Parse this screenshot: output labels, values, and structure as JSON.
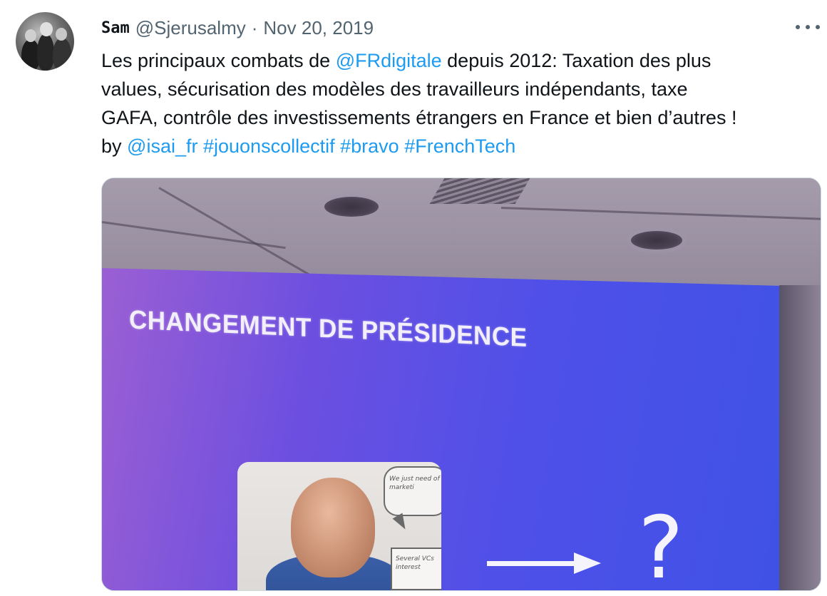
{
  "tweet": {
    "author": {
      "display_name": "Sam",
      "handle": "@Sjerusalmy",
      "separator": "·",
      "date": "Nov 20, 2019"
    },
    "more_icon": "more-horizontal-icon",
    "lines": [
      [
        {
          "text": "Les principaux combats de ",
          "link": false
        },
        {
          "text": "@FRdigitale",
          "link": true
        },
        {
          "text": " depuis 2012: Taxation des plus",
          "link": false
        }
      ],
      [
        {
          "text": "values, sécurisation des modèles des travailleurs indépendants, taxe",
          "link": false
        }
      ],
      [
        {
          "text": "GAFA, contrôle des investissements étrangers en France et bien d’autres !",
          "link": false
        }
      ],
      [
        {
          "text": "by ",
          "link": false
        },
        {
          "text": "@isai_fr",
          "link": true
        },
        {
          "text": " ",
          "link": false
        },
        {
          "text": "#jouonscollectif",
          "link": true
        },
        {
          "text": " ",
          "link": false
        },
        {
          "text": "#bravo",
          "link": true
        },
        {
          "text": " ",
          "link": false
        },
        {
          "text": "#FrenchTech",
          "link": true
        }
      ]
    ],
    "media": {
      "slide_title": "CHANGEMENT DE PRÉSIDENCE",
      "bubble_text": "We just need of marketi",
      "note_text": "Several VCs interest",
      "question_mark": "?"
    },
    "colors": {
      "link": "#1d9bf0",
      "secondary_text": "#536471",
      "primary_text": "#0f1419"
    }
  }
}
